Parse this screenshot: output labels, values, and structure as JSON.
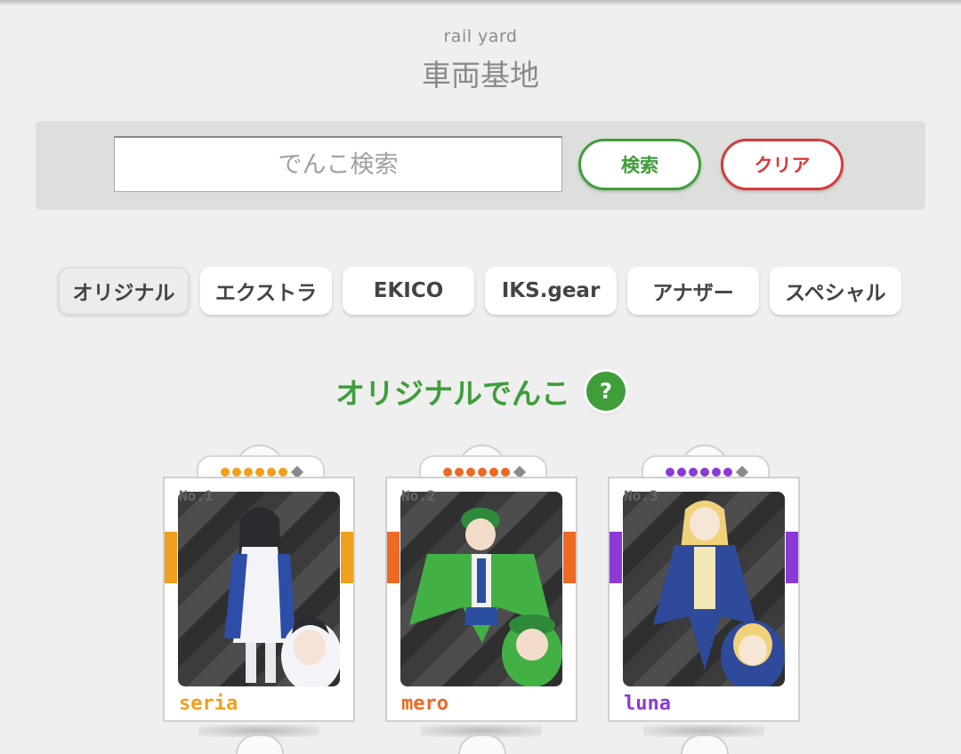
{
  "header": {
    "subtitle": "rail yard",
    "title": "車両基地"
  },
  "search": {
    "placeholder": "でんこ検索",
    "search_label": "検索",
    "clear_label": "クリア"
  },
  "tabs": [
    {
      "label": "オリジナル",
      "active": true
    },
    {
      "label": "エクストラ",
      "active": false
    },
    {
      "label": "EKICO",
      "active": false
    },
    {
      "label": "IKS.gear",
      "active": false
    },
    {
      "label": "アナザー",
      "active": false
    },
    {
      "label": "スペシャル",
      "active": false
    }
  ],
  "section": {
    "title": "オリジナルでんこ",
    "help_icon": "?"
  },
  "cards": [
    {
      "number": "No.1",
      "name": "seria",
      "color": "#f0a01c",
      "rarity_dots": 6
    },
    {
      "number": "No.2",
      "name": "mero",
      "color": "#ec6a24",
      "rarity_dots": 6
    },
    {
      "number": "No.3",
      "name": "luna",
      "color": "#8c3ad6",
      "rarity_dots": 6
    }
  ],
  "colors": {
    "accent_green": "#3f9e3a",
    "accent_red": "#d83a3a"
  }
}
